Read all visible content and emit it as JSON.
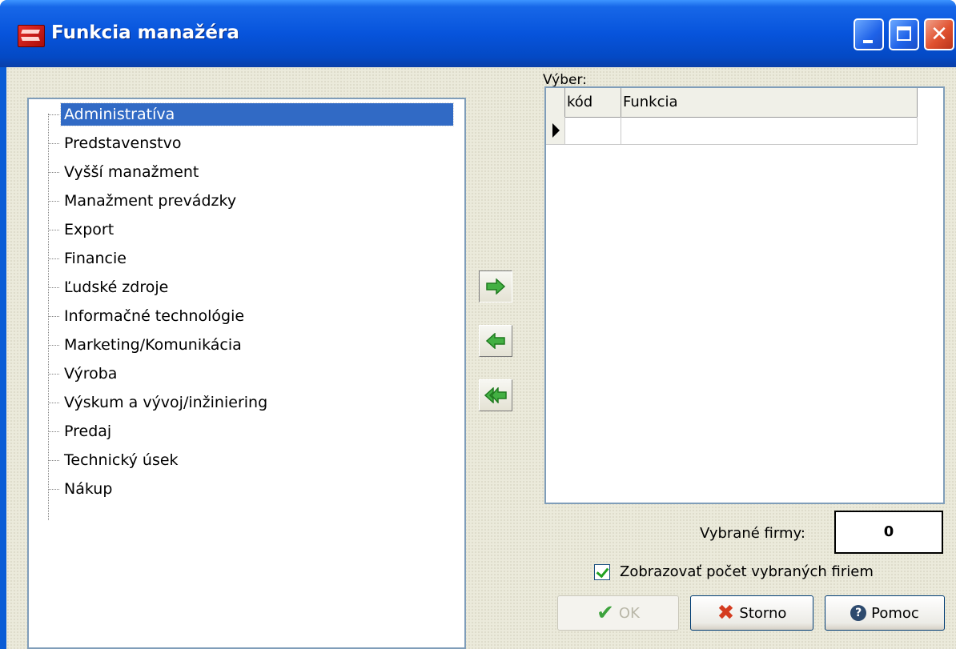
{
  "window": {
    "title": "Funkcia manažéra"
  },
  "tree": {
    "items": [
      "Administratíva",
      "Predstavenstvo",
      "Vyšší manažment",
      "Manažment prevádzky",
      "Export",
      "Financie",
      "Ľudské zdroje",
      "Informačné technológie",
      "Marketing/Komunikácia",
      "Výroba",
      "Výskum a vývoj/inžiniering",
      "Predaj",
      "Technický úsek",
      "Nákup"
    ],
    "selected_index": 0
  },
  "selection": {
    "label": "Výber:",
    "columns": [
      "kód",
      "Funkcia"
    ],
    "rows": []
  },
  "summary": {
    "selected_firms_label": "Vybrané firmy:",
    "selected_firms_count": "0",
    "show_count_label": "Zobrazovať počet vybraných firiem",
    "show_count_checked": true
  },
  "buttons": {
    "ok": "OK",
    "cancel": "Storno",
    "help": "Pomoc"
  },
  "colors": {
    "title_bar": "#0754dc",
    "selection": "#316ac5",
    "arrow_green": "#3aa83a"
  }
}
